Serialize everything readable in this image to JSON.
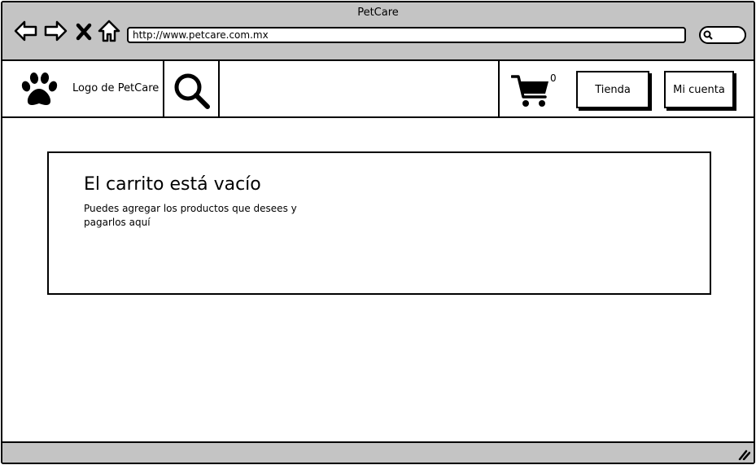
{
  "window": {
    "title": "PetCare"
  },
  "browser": {
    "url": "http://www.petcare.com.mx",
    "icons": [
      "back-arrow-icon",
      "forward-arrow-icon",
      "close-x-icon",
      "home-icon",
      "search-icon"
    ]
  },
  "header": {
    "logo_text": "Logo de PetCare",
    "search_placeholder": "",
    "cart_count": "0",
    "shop_button": "Tienda",
    "account_button": "Mi cuenta"
  },
  "cart": {
    "title": "El carrito está vacío",
    "message": "Puedes agregar los productos que desees y pagarlos aquí"
  }
}
